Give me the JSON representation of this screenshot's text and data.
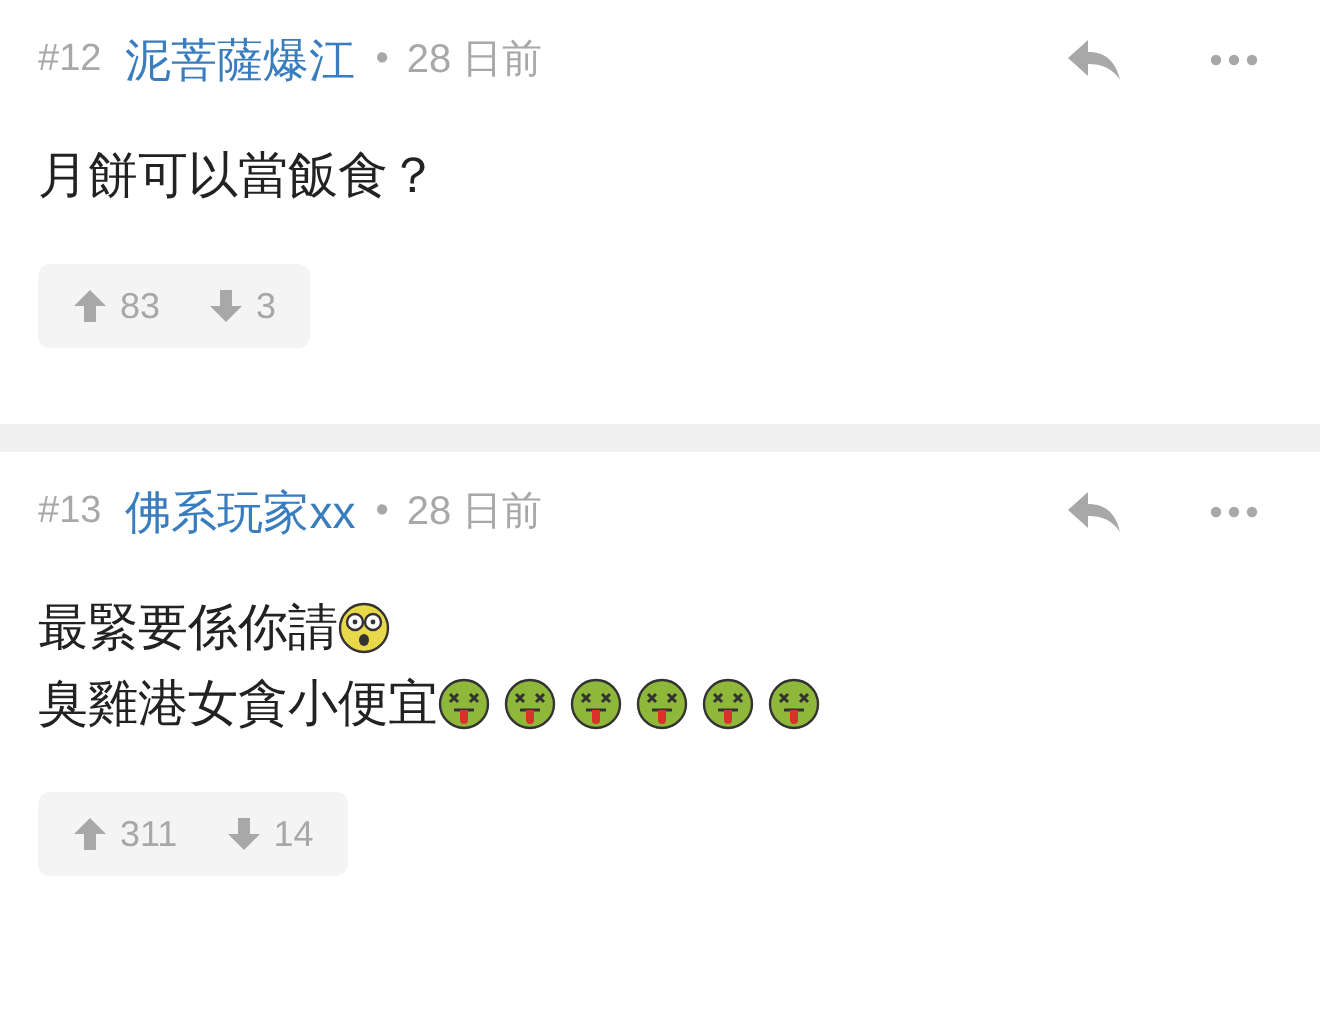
{
  "posts": [
    {
      "number": "#12",
      "author": "泥菩薩爆江",
      "separator": "•",
      "time": "28 日前",
      "lines": [
        [
          {
            "kind": "text",
            "text": "月餅可以當飯食？"
          }
        ]
      ],
      "upvotes": "83",
      "downvotes": "3"
    },
    {
      "number": "#13",
      "author": "佛系玩家xx",
      "separator": "•",
      "time": "28 日前",
      "lines": [
        [
          {
            "kind": "text",
            "text": "最緊要係你請"
          },
          {
            "kind": "shocked"
          }
        ],
        [
          {
            "kind": "text",
            "text": "臭雞港女貪小便宜"
          },
          {
            "kind": "sick"
          },
          {
            "kind": "sick"
          },
          {
            "kind": "sick"
          },
          {
            "kind": "sick"
          },
          {
            "kind": "sick"
          },
          {
            "kind": "sick"
          }
        ]
      ],
      "upvotes": "311",
      "downvotes": "14"
    }
  ]
}
